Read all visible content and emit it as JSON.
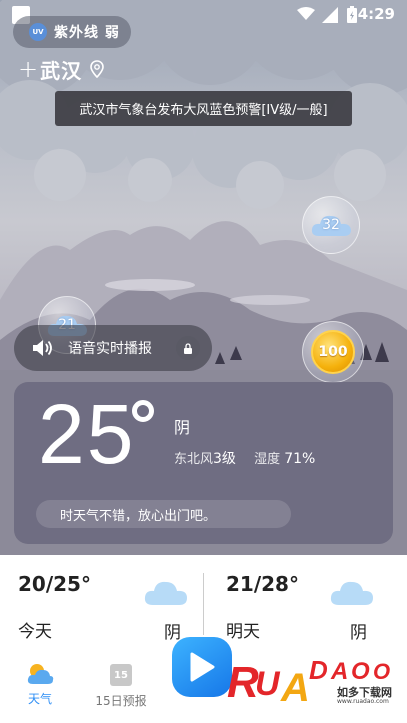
{
  "status_bar": {
    "time": "4:29"
  },
  "uv": {
    "badge": "UV",
    "label": "紫外线 弱"
  },
  "city": {
    "add_label": "+",
    "name": "武汉"
  },
  "alert": {
    "text": "武汉市气象台发布大风蓝色预警[IV级/一般]"
  },
  "bubbles": {
    "left_value": "21",
    "right_value": "32",
    "coin_value": "100"
  },
  "voice": {
    "label": "语音实时播报"
  },
  "current": {
    "temperature": "25",
    "condition": "阴",
    "wind_direction": "东北风",
    "wind_level": "3级",
    "humidity_label": "湿度",
    "humidity_value": "71%",
    "tip": "时天气不错，放心出门吧。"
  },
  "forecast": {
    "today": {
      "range": "20/25°",
      "day": "今天",
      "condition": "阴"
    },
    "tomorrow": {
      "range": "21/28°",
      "day": "明天",
      "condition": "阴"
    }
  },
  "nav": {
    "weather_label": "天气",
    "fifteen_day_label": "15日预报",
    "calendar_number": "15"
  },
  "watermark": {
    "brand": "RUANDAO",
    "text": "如多下载网",
    "url": "www.ruadao.com"
  },
  "colors": {
    "accent": "#2f8ff5",
    "card": "#6a6880",
    "coin": "#f5b10c",
    "play": "#1f8cf0"
  }
}
